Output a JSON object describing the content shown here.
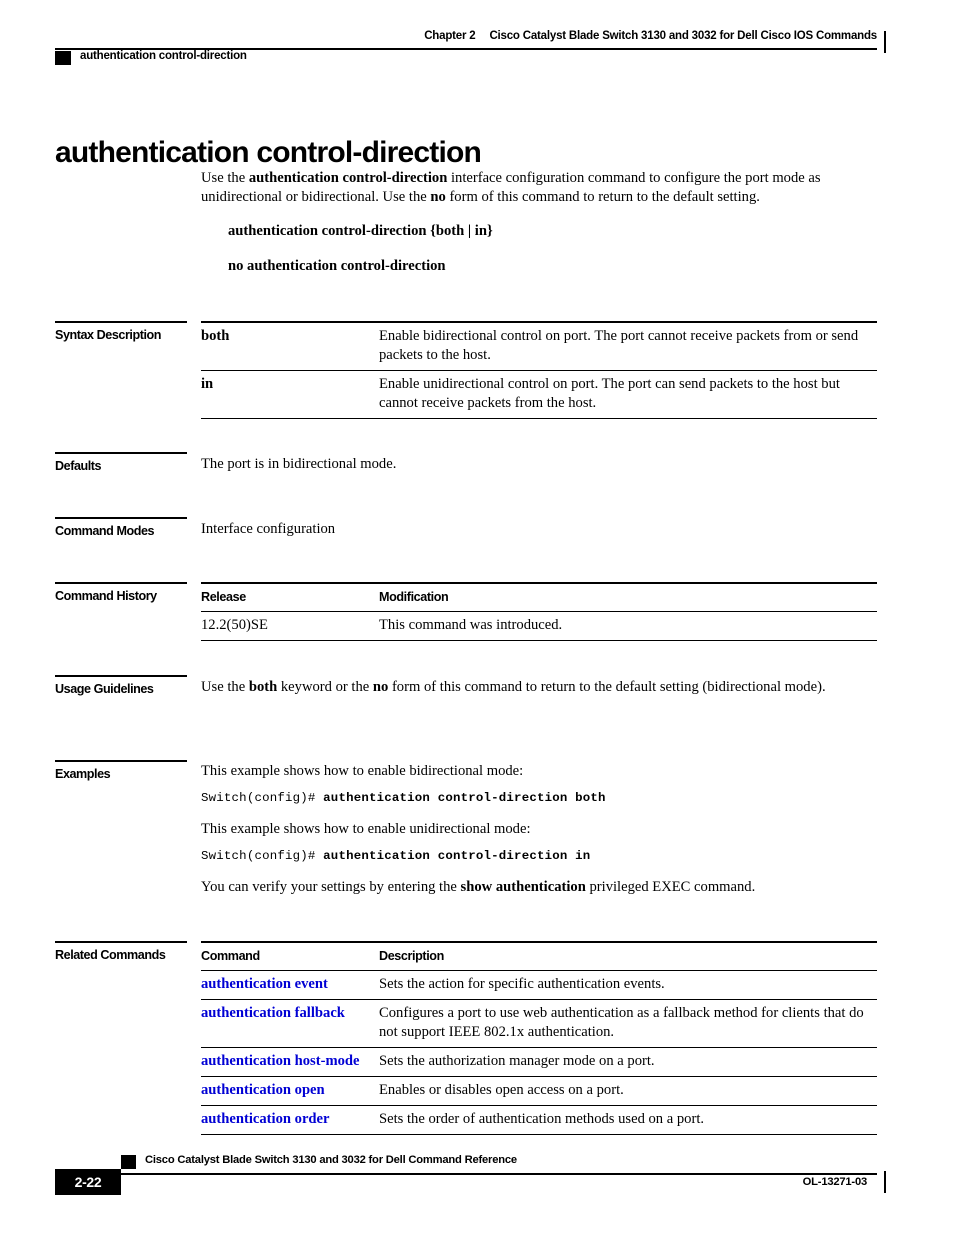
{
  "header": {
    "chapter": "Chapter 2",
    "book_title": "Cisco Catalyst Blade Switch 3130 and 3032 for Dell Cisco IOS Commands",
    "running_head": "authentication control-direction"
  },
  "page": {
    "command_title": "authentication control-direction",
    "intro_prefix": "Use the ",
    "intro_bold1": "authentication control-direction",
    "intro_mid": " interface configuration command to configure the port mode as unidirectional or bidirectional. Use the ",
    "intro_bold2": "no",
    "intro_suffix": " form of this command to return to the default setting.",
    "syntax_line_1": "authentication control-direction {both | in}",
    "syntax_line_2": "no authentication control-direction"
  },
  "sections": {
    "syntax_description": "Syntax Description",
    "defaults": "Defaults",
    "command_modes": "Command Modes",
    "command_history": "Command History",
    "usage_guidelines": "Usage Guidelines",
    "examples": "Examples",
    "related_commands": "Related Commands"
  },
  "syntax_table": {
    "rows": [
      {
        "keyword": "both",
        "description": "Enable bidirectional control on port. The port cannot receive packets from or send packets to the host."
      },
      {
        "keyword": "in",
        "description": "Enable unidirectional control on port. The port can send packets to the host but cannot receive packets from the host."
      }
    ]
  },
  "defaults": {
    "text": "The port is in bidirectional mode."
  },
  "command_modes": {
    "text": "Interface configuration"
  },
  "command_history": {
    "headers": [
      "Release",
      "Modification"
    ],
    "rows": [
      {
        "release": "12.2(50)SE",
        "modification": "This command was introduced."
      }
    ]
  },
  "usage_guidelines": {
    "prefix": "Use the ",
    "bold1": "both",
    "mid": " keyword or the ",
    "bold2": "no",
    "suffix": " form of this command to return to the default setting (bidirectional mode)."
  },
  "examples": {
    "intro_1": "This example shows how to enable bidirectional mode:",
    "prompt_1": "Switch(config)# ",
    "command_1": "authentication control-direction both",
    "intro_2": "This example shows how to enable unidirectional mode:",
    "prompt_2": "Switch(config)# ",
    "command_2": "authentication control-direction in",
    "verify_prefix": "You can verify your settings by entering the ",
    "verify_bold": "show authentication",
    "verify_suffix": " privileged EXEC command."
  },
  "related_commands": {
    "headers": [
      "Command",
      "Description"
    ],
    "rows": [
      {
        "command": "authentication event",
        "description": "Sets the action for specific authentication events."
      },
      {
        "command": "authentication fallback",
        "description": "Configures a port to use web authentication as a fallback method for clients that do not support IEEE 802.1x authentication."
      },
      {
        "command": "authentication host-mode",
        "description": "Sets the authorization manager mode on a port."
      },
      {
        "command": "authentication open",
        "description": "Enables or disables open access on a port."
      },
      {
        "command": "authentication order",
        "description": "Sets the order of authentication methods used on a port."
      }
    ]
  },
  "footer": {
    "book_title": "Cisco Catalyst Blade Switch 3130 and 3032 for Dell Command Reference",
    "page_number": "2-22",
    "doc_id": "OL-13271-03"
  },
  "colors": {
    "link": "#0000D4",
    "text": "#000000",
    "background": "#FFFFFF"
  }
}
